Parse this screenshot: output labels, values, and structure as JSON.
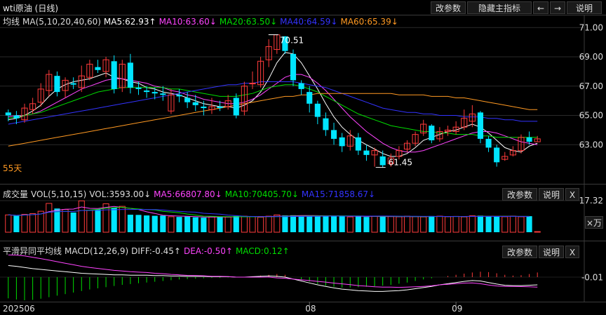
{
  "title": "wti原油 (日线)",
  "toolbar": {
    "params": "改参数",
    "hide": "隐藏主指标",
    "left": "←",
    "right": "→",
    "help": "说明"
  },
  "main_legend": {
    "name": "均线",
    "params": "MA(5,10,20,40,60)",
    "ma5": "MA5:62.93↑",
    "ma10": "MA10:63.60↓",
    "ma20": "MA20:63.50↓",
    "ma40": "MA40:64.59↓",
    "ma60": "MA60:65.39↓"
  },
  "vol_legend": {
    "name": "成交量",
    "params": "VOL(5,10,15)",
    "vol": "VOL:3593.00↓",
    "ma5": "MA5:66807.80↓",
    "ma10": "MA10:70405.70↓",
    "ma15": "MA15:71858.67↓"
  },
  "macd_legend": {
    "name": "平滑异同平均线",
    "params": "MACD(12,26,9)",
    "diff": "DIFF:-0.45↑",
    "dea": "DEA:-0.50↑",
    "macd": "MACD:0.12↑"
  },
  "panel_buttons": {
    "params": "改参数",
    "help": "说明",
    "close": "X"
  },
  "unit_btn": "×万",
  "days_label": "55天",
  "high_label": "70.51",
  "low_label": "61.45",
  "colors": {
    "up": "#ff3b3b",
    "down": "#00e5ff",
    "ma5": "#ffffff",
    "ma10": "#ff44ff",
    "ma20": "#00dd00",
    "ma40": "#3333ff",
    "ma60": "#ff9922"
  },
  "chart_data": [
    {
      "type": "candlestick",
      "title": "wti原油 (日线)",
      "ylim": [
        61.0,
        71.3
      ],
      "y_ticks": [
        "71.00",
        "69.00",
        "67.00",
        "65.00",
        "63.00"
      ],
      "x_ticks": [
        "202506",
        "08",
        "09"
      ],
      "annotations": [
        "70.51",
        "61.45",
        "55天"
      ],
      "candles": [
        [
          65.2,
          65.0,
          65.4,
          64.6
        ],
        [
          65.0,
          64.8,
          65.3,
          64.4
        ],
        [
          64.7,
          65.5,
          65.8,
          64.5
        ],
        [
          65.4,
          65.8,
          66.2,
          65.1
        ],
        [
          65.9,
          66.8,
          67.2,
          65.6
        ],
        [
          66.7,
          67.8,
          68.1,
          66.3
        ],
        [
          67.7,
          66.6,
          68.0,
          66.3
        ],
        [
          66.7,
          67.4,
          67.6,
          66.2
        ],
        [
          67.2,
          67.1,
          67.6,
          66.8
        ],
        [
          66.9,
          67.7,
          68.4,
          66.6
        ],
        [
          67.6,
          68.5,
          68.8,
          67.4
        ],
        [
          68.3,
          68.1,
          68.8,
          67.9
        ],
        [
          68.0,
          68.8,
          69.0,
          67.6
        ],
        [
          68.7,
          66.8,
          69.1,
          66.5
        ],
        [
          66.9,
          68.5,
          68.8,
          66.6
        ],
        [
          68.6,
          66.9,
          69.2,
          66.5
        ],
        [
          66.9,
          66.8,
          67.3,
          66.4
        ],
        [
          66.7,
          66.6,
          67.0,
          66.2
        ],
        [
          66.6,
          66.5,
          66.9,
          66.1
        ],
        [
          66.5,
          66.4,
          67.0,
          66.0
        ],
        [
          65.3,
          66.4,
          66.8,
          65.1
        ],
        [
          66.4,
          66.3,
          66.8,
          65.9
        ],
        [
          66.2,
          65.9,
          66.6,
          65.5
        ],
        [
          65.9,
          65.7,
          66.4,
          65.3
        ],
        [
          65.6,
          65.5,
          66.0,
          65.0
        ],
        [
          65.4,
          65.6,
          66.2,
          65.1
        ],
        [
          65.6,
          65.5,
          66.0,
          65.3
        ],
        [
          65.6,
          66.0,
          66.4,
          65.4
        ],
        [
          66.2,
          65.0,
          66.5,
          64.8
        ],
        [
          65.3,
          67.0,
          67.3,
          65.0
        ],
        [
          67.2,
          67.2,
          68.0,
          66.8
        ],
        [
          67.1,
          68.7,
          69.0,
          66.9
        ],
        [
          68.8,
          69.7,
          70.2,
          68.3
        ],
        [
          69.5,
          70.5,
          70.51,
          69.2
        ],
        [
          70.4,
          69.4,
          70.4,
          69.2
        ],
        [
          69.2,
          67.4,
          69.5,
          67.0
        ],
        [
          67.2,
          66.8,
          67.4,
          66.4
        ],
        [
          66.6,
          65.8,
          67.0,
          65.2
        ],
        [
          65.8,
          64.9,
          66.0,
          64.4
        ],
        [
          64.8,
          64.0,
          65.2,
          63.6
        ],
        [
          64.0,
          63.4,
          64.5,
          63.0
        ],
        [
          63.5,
          62.9,
          63.8,
          62.5
        ],
        [
          62.9,
          63.6,
          64.0,
          62.6
        ],
        [
          63.5,
          62.6,
          63.8,
          62.3
        ],
        [
          62.6,
          62.3,
          63.0,
          61.9
        ],
        [
          62.3,
          62.6,
          62.8,
          61.5
        ],
        [
          62.2,
          61.6,
          62.6,
          61.45
        ],
        [
          61.7,
          62.1,
          62.4,
          61.5
        ],
        [
          62.2,
          62.6,
          62.9,
          62.0
        ],
        [
          62.7,
          63.1,
          63.3,
          62.5
        ],
        [
          63.1,
          63.7,
          63.9,
          62.9
        ],
        [
          63.8,
          64.4,
          64.7,
          63.6
        ],
        [
          64.3,
          63.3,
          64.4,
          63.1
        ],
        [
          63.4,
          63.9,
          64.2,
          63.2
        ],
        [
          63.9,
          64.0,
          64.3,
          63.6
        ],
        [
          63.9,
          64.2,
          64.6,
          63.7
        ],
        [
          64.2,
          64.8,
          65.4,
          64.0
        ],
        [
          64.6,
          65.1,
          65.7,
          64.2
        ],
        [
          65.2,
          63.4,
          65.3,
          63.1
        ],
        [
          63.4,
          62.8,
          63.6,
          62.5
        ],
        [
          62.8,
          61.8,
          63.0,
          61.5
        ],
        [
          62.0,
          62.2,
          62.5,
          61.9
        ],
        [
          62.3,
          62.6,
          62.9,
          62.2
        ],
        [
          62.6,
          63.5,
          63.7,
          62.4
        ],
        [
          63.5,
          63.2,
          63.9,
          63.0
        ],
        [
          63.2,
          63.4,
          63.6,
          63.2
        ]
      ],
      "ma_approx": {
        "MA5": [
          64.7,
          64.8,
          65.0,
          65.3,
          65.7,
          66.3,
          66.8,
          67.1,
          67.3,
          67.4,
          67.5,
          67.7,
          67.9,
          67.6,
          67.5,
          67.3,
          67.2,
          66.9,
          66.8,
          66.6,
          66.5,
          66.4,
          66.2,
          66.0,
          65.8,
          65.7,
          65.6,
          65.6,
          65.5,
          65.7,
          66.0,
          66.6,
          67.5,
          68.6,
          69.3,
          69.2,
          68.6,
          67.7,
          66.8,
          65.8,
          64.9,
          64.2,
          63.7,
          63.3,
          63.0,
          62.7,
          62.4,
          62.2,
          62.2,
          62.4,
          62.8,
          63.3,
          63.5,
          63.7,
          63.9,
          64.0,
          64.2,
          64.4,
          64.2,
          63.8,
          63.3,
          62.8,
          62.6,
          62.5,
          62.9,
          63.1
        ],
        "MA10": [
          64.9,
          65.0,
          65.0,
          65.1,
          65.3,
          65.6,
          65.9,
          66.2,
          66.5,
          66.8,
          67.0,
          67.2,
          67.4,
          67.5,
          67.5,
          67.4,
          67.3,
          67.2,
          67.0,
          66.9,
          66.7,
          66.6,
          66.4,
          66.3,
          66.1,
          66.0,
          65.9,
          65.8,
          65.8,
          65.9,
          66.1,
          66.4,
          66.8,
          67.2,
          67.6,
          67.8,
          67.8,
          67.6,
          67.2,
          66.7,
          66.1,
          65.5,
          64.9,
          64.4,
          63.9,
          63.5,
          63.1,
          62.8,
          62.6,
          62.5,
          62.5,
          62.6,
          62.8,
          63.0,
          63.2,
          63.4,
          63.6,
          63.8,
          63.9,
          63.9,
          63.8,
          63.6,
          63.4,
          63.2,
          63.1,
          63.0
        ],
        "MA20": [
          64.8,
          64.9,
          65.0,
          65.1,
          65.2,
          65.4,
          65.6,
          65.8,
          66.0,
          66.2,
          66.4,
          66.6,
          66.7,
          66.8,
          66.9,
          66.9,
          66.9,
          66.9,
          66.9,
          66.9,
          66.8,
          66.8,
          66.7,
          66.6,
          66.5,
          66.4,
          66.3,
          66.3,
          66.3,
          66.4,
          66.5,
          66.7,
          66.9,
          67.0,
          67.1,
          67.1,
          67.0,
          66.8,
          66.6,
          66.3,
          66.0,
          65.7,
          65.4,
          65.1,
          64.9,
          64.7,
          64.5,
          64.3,
          64.2,
          64.1,
          64.0,
          63.9,
          63.9,
          63.8,
          63.8,
          63.7,
          63.7,
          63.7,
          63.6,
          63.6,
          63.5,
          63.5,
          63.5,
          63.5,
          63.5,
          63.5
        ],
        "MA40": [
          64.4,
          64.5,
          64.6,
          64.7,
          64.8,
          64.9,
          65.0,
          65.1,
          65.2,
          65.3,
          65.4,
          65.5,
          65.6,
          65.7,
          65.8,
          65.9,
          66.0,
          66.1,
          66.2,
          66.3,
          66.4,
          66.5,
          66.6,
          66.7,
          66.8,
          66.9,
          67.0,
          67.1,
          67.1,
          67.2,
          67.2,
          67.3,
          67.3,
          67.3,
          67.3,
          67.3,
          67.2,
          67.1,
          67.0,
          66.9,
          66.7,
          66.5,
          66.3,
          66.1,
          65.9,
          65.7,
          65.5,
          65.4,
          65.3,
          65.2,
          65.2,
          65.1,
          65.1,
          65.0,
          65.0,
          65.0,
          64.9,
          64.9,
          64.9,
          64.8,
          64.8,
          64.7,
          64.7,
          64.6,
          64.6,
          64.6
        ],
        "MA60": [
          62.9,
          63.0,
          63.1,
          63.2,
          63.3,
          63.4,
          63.5,
          63.6,
          63.7,
          63.8,
          63.9,
          64.0,
          64.1,
          64.2,
          64.3,
          64.4,
          64.5,
          64.6,
          64.7,
          64.8,
          64.9,
          65.0,
          65.1,
          65.2,
          65.3,
          65.4,
          65.5,
          65.6,
          65.7,
          65.8,
          65.9,
          66.0,
          66.1,
          66.2,
          66.3,
          66.3,
          66.4,
          66.4,
          66.5,
          66.5,
          66.5,
          66.5,
          66.5,
          66.5,
          66.5,
          66.5,
          66.5,
          66.5,
          66.4,
          66.4,
          66.4,
          66.4,
          66.3,
          66.3,
          66.3,
          66.2,
          66.2,
          66.1,
          66.0,
          65.9,
          65.8,
          65.7,
          65.6,
          65.5,
          65.4,
          65.4
        ]
      }
    },
    {
      "type": "bar",
      "title": "成交量",
      "unit": "×万",
      "y_ticks": [
        "17.32"
      ],
      "values": [
        9.5,
        9.0,
        9.8,
        10.2,
        11.5,
        15.8,
        13.0,
        12.5,
        10.8,
        17.2,
        12.0,
        12.5,
        15.6,
        13.5,
        14.2,
        9.6,
        9.5,
        9.2,
        9.0,
        9.1,
        8.5,
        8.4,
        8.6,
        8.2,
        8.0,
        8.4,
        8.6,
        8.3,
        8.9,
        8.8,
        8.5,
        8.2,
        8.8,
        9.5,
        9.2,
        9.3,
        8.8,
        9.0,
        9.1,
        8.8,
        8.9,
        8.7,
        8.4,
        9.0,
        8.4,
        8.8,
        8.5,
        8.6,
        8.5,
        8.8,
        8.6,
        8.4,
        8.9,
        8.8,
        8.5,
        8.7,
        8.4,
        9.0,
        9.1,
        8.7,
        8.6,
        8.5,
        8.8,
        8.5,
        8.8,
        0.36
      ],
      "up": [
        true,
        false,
        true,
        true,
        true,
        true,
        false,
        true,
        false,
        true,
        true,
        false,
        true,
        false,
        true,
        false,
        false,
        false,
        false,
        false,
        true,
        false,
        false,
        false,
        false,
        true,
        false,
        true,
        false,
        true,
        true,
        true,
        true,
        true,
        false,
        false,
        false,
        false,
        false,
        false,
        false,
        false,
        true,
        false,
        false,
        true,
        false,
        true,
        true,
        true,
        true,
        true,
        false,
        true,
        true,
        true,
        true,
        true,
        false,
        false,
        false,
        true,
        true,
        true,
        false,
        true
      ]
    },
    {
      "type": "bar",
      "title": "平滑异同平均线",
      "y_ticks": [
        "-0.01"
      ],
      "macd": [
        -0.55,
        -0.58,
        -0.6,
        -0.59,
        -0.56,
        -0.52,
        -0.48,
        -0.44,
        -0.4,
        -0.36,
        -0.32,
        -0.29,
        -0.26,
        -0.23,
        -0.2,
        -0.18,
        -0.16,
        -0.14,
        -0.12,
        -0.1,
        -0.08,
        -0.06,
        -0.05,
        -0.04,
        -0.03,
        -0.02,
        -0.02,
        -0.01,
        0.0,
        0.0,
        0.02,
        0.04,
        0.06,
        0.08,
        0.06,
        0.0,
        -0.06,
        -0.12,
        -0.18,
        -0.22,
        -0.25,
        -0.27,
        -0.27,
        -0.26,
        -0.25,
        -0.24,
        -0.22,
        -0.2,
        -0.17,
        -0.14,
        -0.1,
        -0.06,
        -0.03,
        0.0,
        0.03,
        0.06,
        0.09,
        0.12,
        0.14,
        0.13,
        0.1,
        0.06,
        0.04,
        0.05,
        0.08,
        0.12
      ]
    }
  ]
}
